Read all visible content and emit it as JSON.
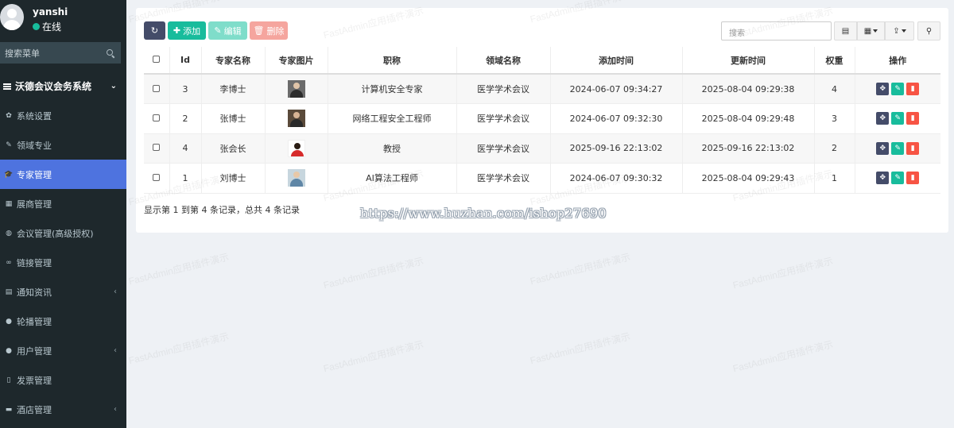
{
  "user": {
    "name": "yanshi",
    "status": "在线"
  },
  "sidebar": {
    "search_placeholder": "搜索菜单",
    "header": "沃德会议会务系统",
    "items": [
      {
        "label": "系统设置",
        "icon": "gear-icon",
        "glyph": "✿",
        "chevron": ""
      },
      {
        "label": "领域专业",
        "icon": "pencil-icon",
        "glyph": "✎",
        "chevron": ""
      },
      {
        "label": "专家管理",
        "icon": "graduation-cap-icon",
        "glyph": "🎓",
        "chevron": ""
      },
      {
        "label": "展商管理",
        "icon": "building-icon",
        "glyph": "▦",
        "chevron": ""
      },
      {
        "label": "会议管理(高级授权)",
        "icon": "chat-icon",
        "glyph": "◍",
        "chevron": ""
      },
      {
        "label": "链接管理",
        "icon": "link-icon",
        "glyph": "∞",
        "chevron": ""
      },
      {
        "label": "通知资讯",
        "icon": "newspaper-icon",
        "glyph": "▤",
        "chevron": "‹"
      },
      {
        "label": "轮播管理",
        "icon": "play-icon",
        "glyph": "●",
        "chevron": ""
      },
      {
        "label": "用户管理",
        "icon": "user-icon",
        "glyph": "●",
        "chevron": "‹"
      },
      {
        "label": "发票管理",
        "icon": "file-icon",
        "glyph": "▯",
        "chevron": ""
      },
      {
        "label": "酒店管理",
        "icon": "bed-icon",
        "glyph": "▬",
        "chevron": "‹"
      }
    ]
  },
  "toolbar": {
    "refresh_glyph": "↻",
    "add_label": "添加",
    "edit_label": "编辑",
    "delete_label": "删除",
    "search_placeholder": "搜索"
  },
  "table": {
    "columns": [
      "Id",
      "专家名称",
      "专家图片",
      "职称",
      "领域名称",
      "添加时间",
      "更新时间",
      "权重",
      "操作"
    ],
    "rows": [
      {
        "id": "3",
        "name": "李博士",
        "title": "计算机安全专家",
        "field": "医学学术会议",
        "created": "2024-06-07 09:34:27",
        "updated": "2025-08-04 09:29:38",
        "weight": "4"
      },
      {
        "id": "2",
        "name": "张博士",
        "title": "网络工程安全工程师",
        "field": "医学学术会议",
        "created": "2024-06-07 09:32:30",
        "updated": "2025-08-04 09:29:48",
        "weight": "3"
      },
      {
        "id": "4",
        "name": "张会长",
        "title": "教授",
        "field": "医学学术会议",
        "created": "2025-09-16 22:13:02",
        "updated": "2025-09-16 22:13:02",
        "weight": "2"
      },
      {
        "id": "1",
        "name": "刘博士",
        "title": "AI算法工程师",
        "field": "医学学术会议",
        "created": "2024-06-07 09:30:32",
        "updated": "2025-08-04 09:29:43",
        "weight": "1"
      }
    ]
  },
  "pagination": {
    "summary": "显示第 1 到第 4 条记录，总共 4 条记录"
  },
  "overlay_url": "https://www.huzhan.com/ishop27690",
  "watermark": "FastAdmin应用插件演示",
  "colors": {
    "primary": "#444c69",
    "success": "#18bc9c",
    "danger": "#f75444",
    "active_menu": "#4e73df",
    "sidebar_bg": "#1e282c"
  }
}
